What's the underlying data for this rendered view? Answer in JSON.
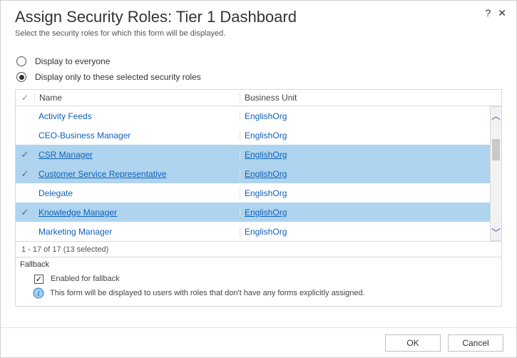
{
  "header": {
    "title": "Assign Security Roles: Tier 1 Dashboard",
    "subtitle": "Select the security roles for which this form will be displayed.",
    "help_label": "?",
    "close_label": "✕"
  },
  "options": {
    "everyone": "Display to everyone",
    "selected": "Display only to these selected security roles",
    "choice": "selected"
  },
  "table": {
    "columns": {
      "name": "Name",
      "bu": "Business Unit"
    },
    "rows": [
      {
        "name": "Activity Feeds",
        "bu": "EnglishOrg",
        "selected": false
      },
      {
        "name": "CEO-Business Manager",
        "bu": "EnglishOrg",
        "selected": false
      },
      {
        "name": "CSR Manager",
        "bu": "EnglishOrg",
        "selected": true
      },
      {
        "name": "Customer Service Representative",
        "bu": "EnglishOrg",
        "selected": true
      },
      {
        "name": "Delegate",
        "bu": "EnglishOrg",
        "selected": false
      },
      {
        "name": "Knowledge Manager",
        "bu": "EnglishOrg",
        "selected": true
      },
      {
        "name": "Marketing Manager",
        "bu": "EnglishOrg",
        "selected": false
      }
    ],
    "pager": "1 - 17 of 17 (13 selected)"
  },
  "fallback": {
    "section": "Fallback",
    "checked": true,
    "label": "Enabled for fallback",
    "info": "This form will be displayed to users with roles that don't have any forms explicitly assigned."
  },
  "footer": {
    "ok": "OK",
    "cancel": "Cancel"
  }
}
